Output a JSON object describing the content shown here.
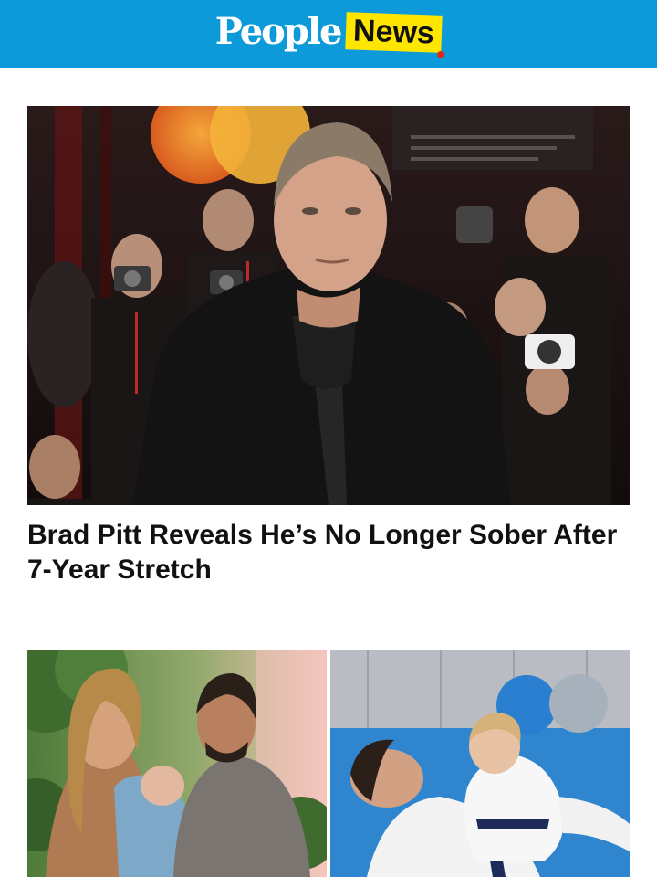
{
  "header": {
    "logo_people": "People",
    "logo_news": "News",
    "brand_color": "#0c9bd8",
    "news_badge_color": "#ffe600"
  },
  "articles": [
    {
      "headline": "Brad Pitt Reveals He’s No Longer Sober After 7-Year Stretch",
      "image": "red-carpet-photo"
    }
  ],
  "gallery": [
    {
      "image": "family-beach-photo"
    },
    {
      "image": "jiu-jitsu-mat-photo"
    }
  ]
}
